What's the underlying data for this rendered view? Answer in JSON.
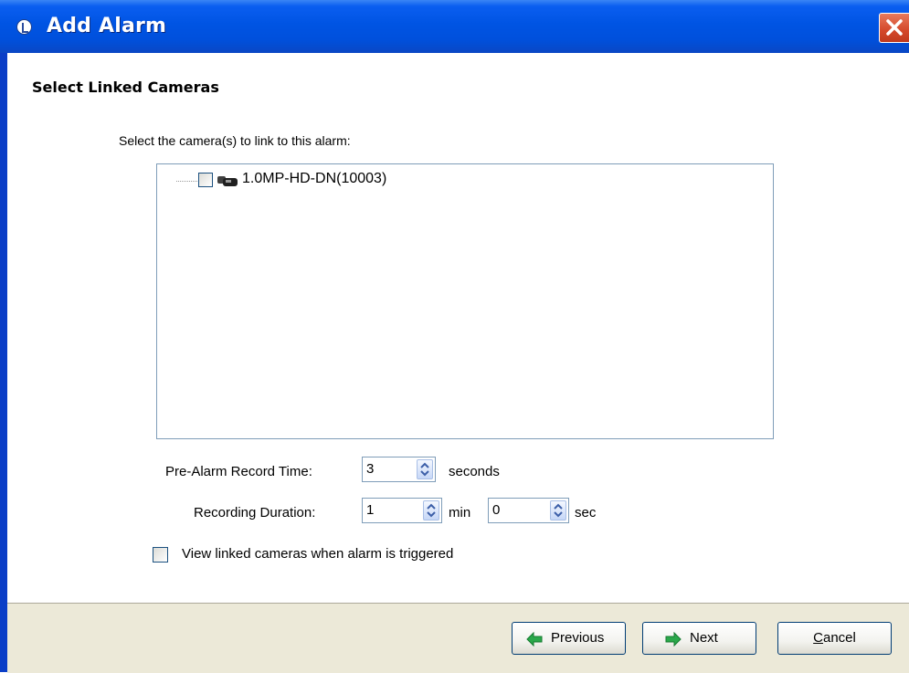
{
  "window": {
    "title": "Add Alarm"
  },
  "section": {
    "title": "Select Linked Cameras"
  },
  "camera_select": {
    "label": "Select the camera(s) to link to this alarm:",
    "cameras": [
      {
        "name": "1.0MP-HD-DN(10003)",
        "checked": false
      }
    ]
  },
  "pre_alarm": {
    "label": "Pre-Alarm Record Time:",
    "value": "3",
    "unit": "seconds"
  },
  "duration": {
    "label": "Recording Duration:",
    "min_value": "1",
    "min_unit": "min",
    "sec_value": "0",
    "sec_unit": "sec"
  },
  "view_linked": {
    "label": "View linked cameras when alarm is triggered",
    "checked": false
  },
  "buttons": {
    "previous": "Previous",
    "next": "Next",
    "cancel_first": "C",
    "cancel_rest": "ancel"
  },
  "colors": {
    "titlebar": "#0054e3",
    "footer": "#ece9d8",
    "close": "#d4482a",
    "arrow_green": "#2aa84a"
  }
}
